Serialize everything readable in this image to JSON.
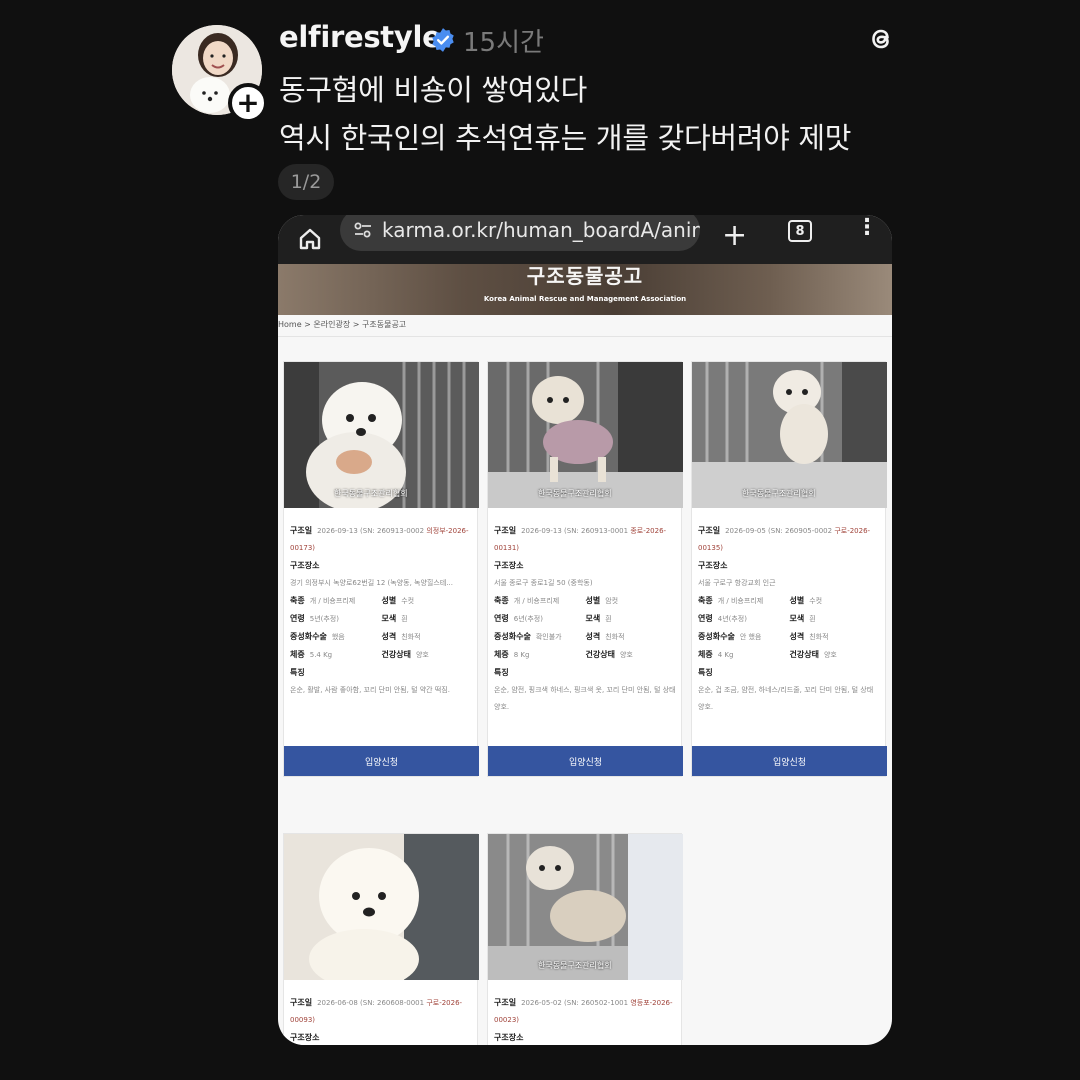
{
  "post": {
    "username": "elfirestyle",
    "time": "15시간",
    "line1": "동구협에 비숑이 쌓여있다",
    "line2": "역시 한국인의 추석연휴는 개를 갖다버려야 제맛",
    "page_indicator": "1/2",
    "avatar_badge": "+"
  },
  "browser": {
    "url": "karma.or.kr/human_boardA/anima",
    "tab_count": "8",
    "new_tab": "+",
    "menu": "⋮"
  },
  "site": {
    "banner_title": "구조동물공고",
    "banner_subtitle": "Korea Animal Rescue and Management Association",
    "breadcrumb": "Home > 온라인광장 > 구조동물공고",
    "watermark": "한국동물구조관리협회",
    "adopt_label": "입양신청"
  },
  "labels": {
    "rescue_date": "구조일",
    "location": "구조장소",
    "breed": "축종",
    "sex": "성별",
    "age": "연령",
    "color": "모색",
    "neuter": "중성화수술",
    "temperament": "성격",
    "weight": "체중",
    "health": "건강상태",
    "features": "특징"
  },
  "animals": [
    {
      "date": "2026-09-13",
      "sn": "(SN: 260913-0002",
      "region_code": "의정부-2026-00173)",
      "location": "경기 의정부시 녹양로62번길 12 (녹양동, 녹양힐스테...",
      "breed": "개 / 비숑프리제",
      "sex": "수컷",
      "age": "5년(추정)",
      "color": "흰",
      "neuter": "했음",
      "temperament": "친화적",
      "weight": "5.4 Kg",
      "health": "양호",
      "features": "온순, 활발, 사람 좋아함, 꼬리 단미 안됨, 털 약간 떡짐."
    },
    {
      "date": "2026-09-13",
      "sn": "(SN: 260913-0001",
      "region_code": "종로-2026-00131)",
      "location": "서울 종로구 종로1길 50 (중학동)",
      "breed": "개 / 비숑프리제",
      "sex": "암컷",
      "age": "6년(추정)",
      "color": "흰",
      "neuter": "확인불가",
      "temperament": "친화적",
      "weight": "8 Kg",
      "health": "양호",
      "features": "온순, 얌전, 핑크색 하네스, 핑크색 옷, 꼬리 단미 안됨, 털 상태 양호."
    },
    {
      "date": "2026-09-05",
      "sn": "(SN: 260905-0002",
      "region_code": "구로-2026-00135)",
      "location": "서울 구로구 항강교회 인근",
      "breed": "개 / 비숑프리제",
      "sex": "수컷",
      "age": "4년(추정)",
      "color": "흰",
      "neuter": "안 했음",
      "temperament": "친화적",
      "weight": "4 Kg",
      "health": "양호",
      "features": "온순, 겁 조금, 얌전, 하네스/리드줄, 꼬리 단미 안됨, 털 상태 양호."
    },
    {
      "date": "2026-06-08",
      "sn": "(SN: 260608-0001",
      "region_code": "구로-2026-00093)"
    },
    {
      "date": "2026-05-02",
      "sn": "(SN: 260502-1001",
      "region_code": "영등포-2026-00023)"
    }
  ]
}
